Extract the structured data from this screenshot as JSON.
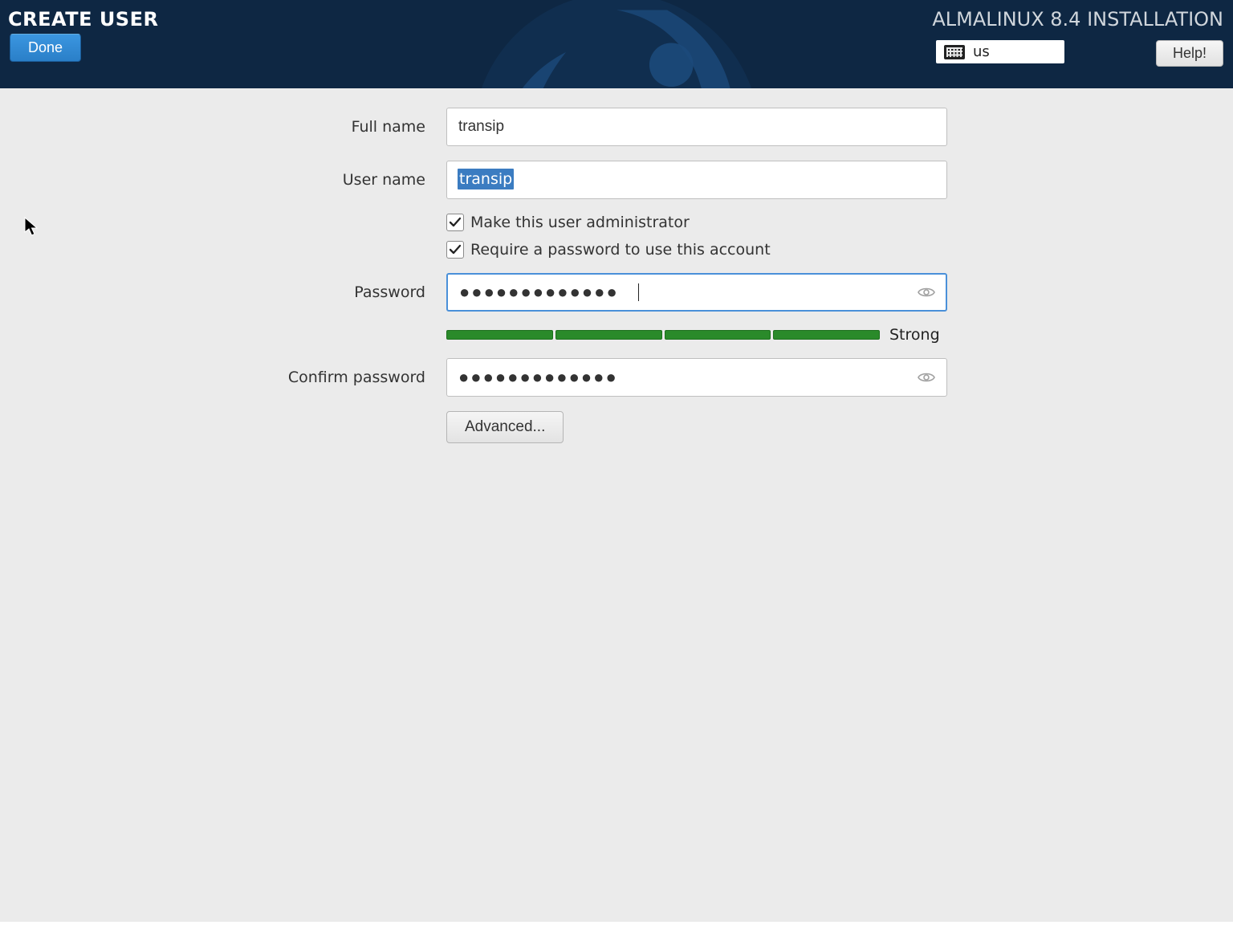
{
  "header": {
    "screen_title": "CREATE USER",
    "done_label": "Done",
    "installation_title": "ALMALINUX 8.4 INSTALLATION",
    "keyboard_layout": "us",
    "help_label": "Help!"
  },
  "form": {
    "full_name": {
      "label": "Full name",
      "value": "transip"
    },
    "user_name": {
      "label": "User name",
      "value": "transip",
      "selected": true
    },
    "make_admin": {
      "label": "Make this user administrator",
      "checked": true
    },
    "require_password": {
      "label": "Require a password to use this account",
      "checked": true
    },
    "password": {
      "label": "Password",
      "value": "●●●●●●●●●●●●●"
    },
    "password_strength": {
      "label": "Strong",
      "segments": 4,
      "filled": 4,
      "color": "#2a8a2a"
    },
    "confirm_password": {
      "label": "Confirm password",
      "value": "●●●●●●●●●●●●●"
    },
    "advanced_label": "Advanced..."
  }
}
